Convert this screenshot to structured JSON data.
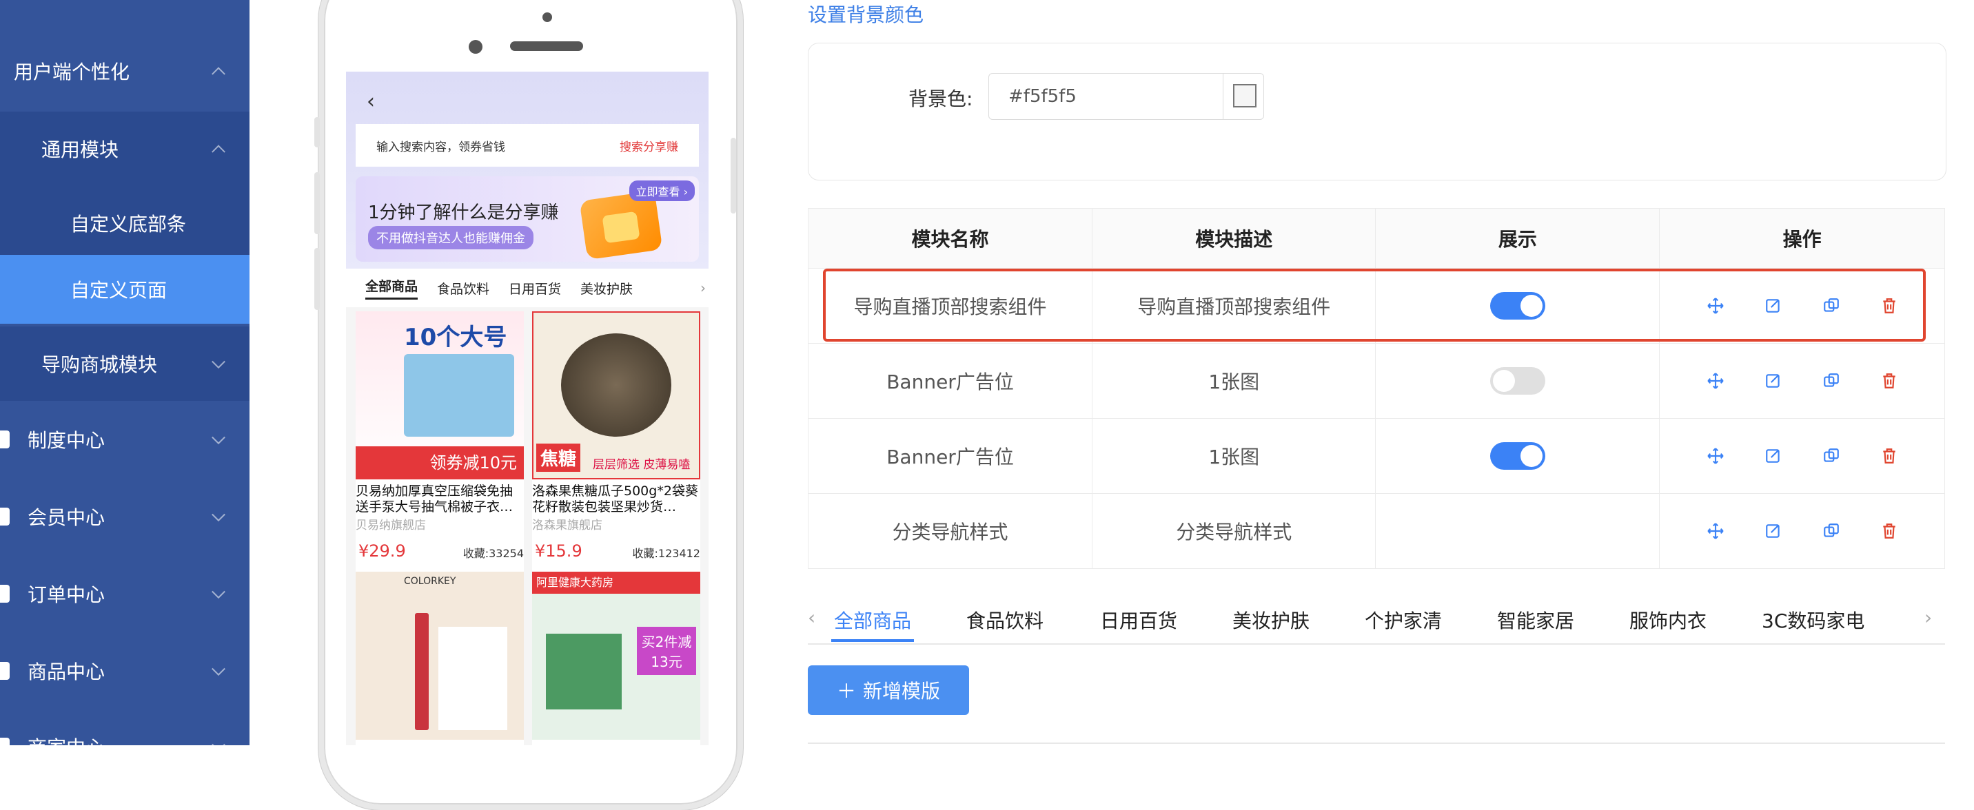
{
  "sidebar": {
    "items": [
      {
        "label": "用户端个性化"
      },
      {
        "label": "通用模块"
      },
      {
        "label": "自定义底部条"
      },
      {
        "label": "自定义页面"
      },
      {
        "label": "导购商城模块"
      },
      {
        "label": "制度中心"
      },
      {
        "label": "会员中心"
      },
      {
        "label": "订单中心"
      },
      {
        "label": "商品中心"
      }
    ],
    "partial_bottom": "商家中心"
  },
  "phone": {
    "search_placeholder": "输入搜索内容，领券省钱",
    "search_action": "搜索分享赚",
    "banner_title": "1分钟了解什么是分享赚",
    "banner_subtitle": "不用做抖音达人也能赚佣金",
    "banner_tag": "立即查看 ›",
    "tabs": [
      "全部商品",
      "食品饮料",
      "日用百货",
      "美妆护肤"
    ],
    "products": [
      {
        "title": "贝易纳加厚真空压缩袋免抽送手泵大号抽气棉被子衣…",
        "shop": "贝易纳旗舰店",
        "price": "¥29.9",
        "fav": "收藏:33254",
        "img_text": "10个大号",
        "img_sub": "领券减10元"
      },
      {
        "title": "洛森果焦糖瓜子500g*2袋葵花籽散装包装坚果炒货…",
        "shop": "洛森果旗舰店",
        "price": "¥15.9",
        "fav": "收藏:123412",
        "img_text": "焦糖",
        "img_sub": "层层筛选 皮薄易嗑"
      },
      {
        "img_text": "COLORKEY"
      },
      {
        "img_text": "阿里健康大药房",
        "img_sub": "买2件减13元"
      }
    ]
  },
  "panel": {
    "section_title": "设置背景颜色",
    "bg_label": "背景色:",
    "bg_value": "#f5f5f5",
    "table": {
      "headers": [
        "模块名称",
        "模块描述",
        "展示",
        "操作"
      ],
      "rows": [
        {
          "name": "导购直播顶部搜索组件",
          "desc": "导购直播顶部搜索组件",
          "show": true
        },
        {
          "name": "Banner广告位",
          "desc": "1张图",
          "show": false
        },
        {
          "name": "Banner广告位",
          "desc": "1张图",
          "show": true
        },
        {
          "name": "分类导航样式",
          "desc": "分类导航样式",
          "show": null
        }
      ]
    },
    "tabs": [
      "全部商品",
      "食品饮料",
      "日用百货",
      "美妆护肤",
      "个护家清",
      "智能家居",
      "服饰内衣",
      "3C数码家电"
    ],
    "add_button": "新增模版"
  },
  "colors": {
    "sidebar": "#34549a",
    "accent": "#4b90f1",
    "danger": "#e0452f"
  }
}
